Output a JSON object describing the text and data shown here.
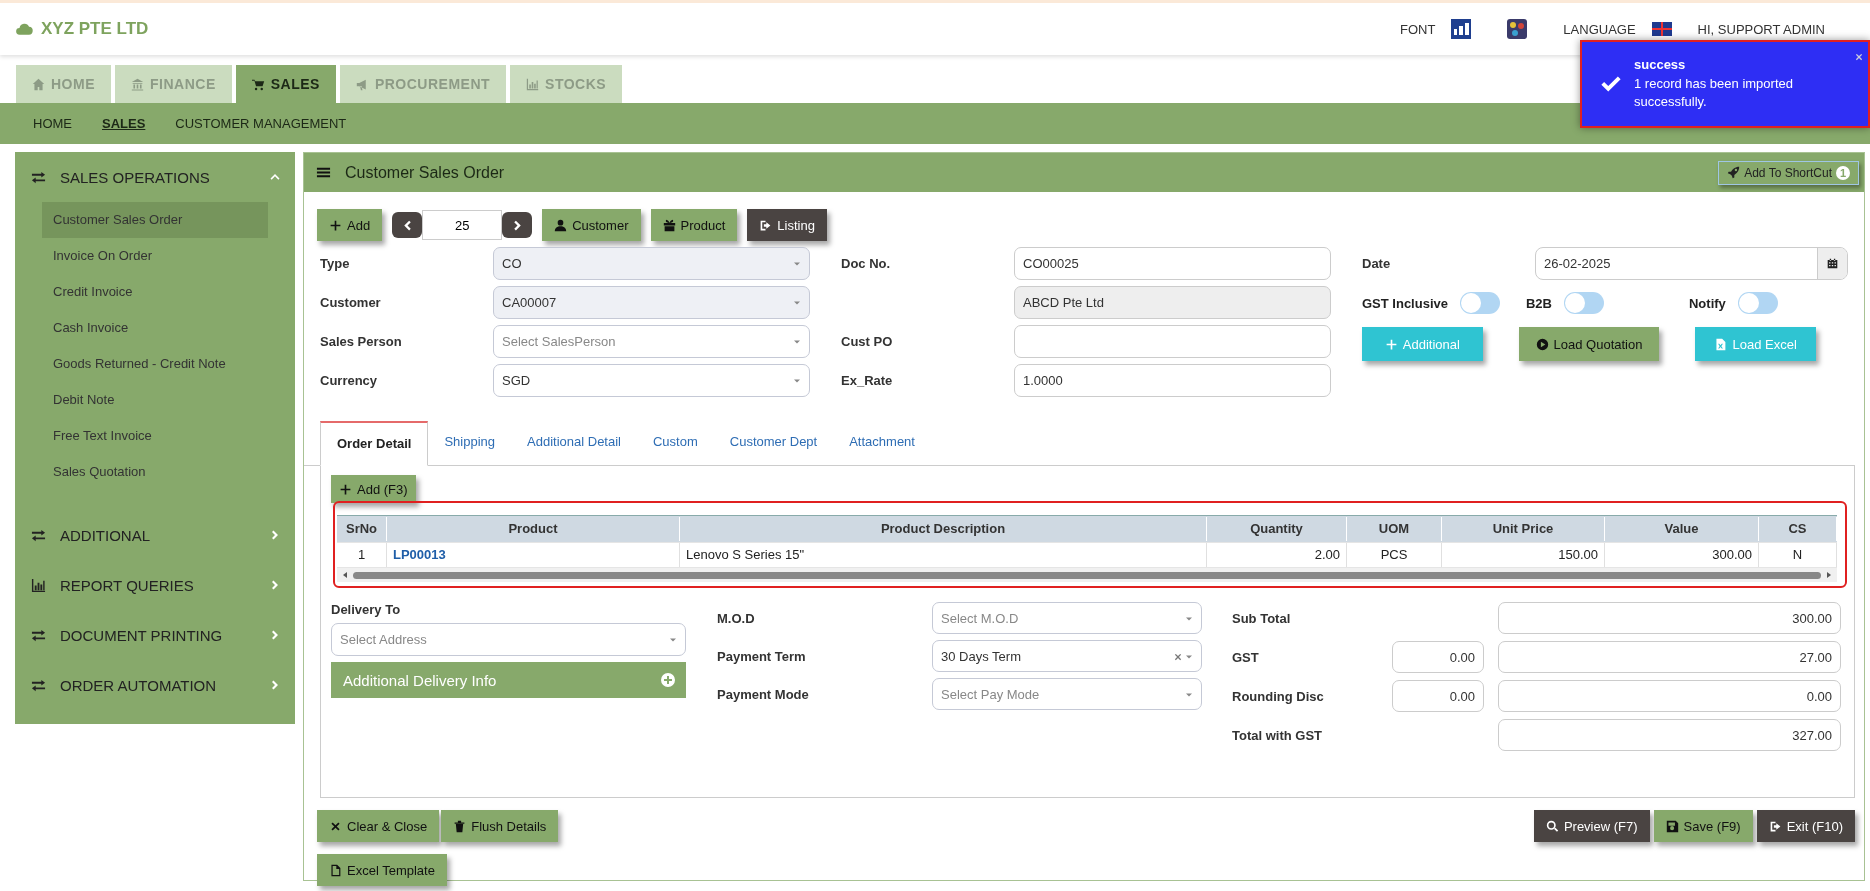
{
  "header": {
    "company": "XYZ PTE LTD",
    "font_label": "FONT",
    "language_label": "LANGUAGE",
    "user": "HI, SUPPORT ADMIN"
  },
  "toast": {
    "title": "success",
    "message": "1 record has been imported successfully."
  },
  "module_tabs": [
    {
      "label": "HOME",
      "selected": false
    },
    {
      "label": "FINANCE",
      "selected": false
    },
    {
      "label": "SALES",
      "selected": true
    },
    {
      "label": "PROCUREMENT",
      "selected": false
    },
    {
      "label": "STOCKS",
      "selected": false
    }
  ],
  "sub_nav": [
    {
      "label": "HOME",
      "selected": false
    },
    {
      "label": "SALES",
      "selected": true
    },
    {
      "label": "CUSTOMER MANAGEMENT",
      "selected": false
    }
  ],
  "sidebar": [
    {
      "title": "SALES OPERATIONS",
      "expanded": true,
      "children": [
        {
          "label": "Customer Sales Order",
          "selected": true
        },
        {
          "label": "Invoice On Order",
          "selected": false
        },
        {
          "label": "Credit Invoice",
          "selected": false
        },
        {
          "label": "Cash Invoice",
          "selected": false
        },
        {
          "label": "Goods Returned - Credit Note",
          "selected": false
        },
        {
          "label": "Debit Note",
          "selected": false
        },
        {
          "label": "Free Text Invoice",
          "selected": false
        },
        {
          "label": "Sales Quotation",
          "selected": false
        }
      ]
    },
    {
      "title": "ADDITIONAL",
      "expanded": false
    },
    {
      "title": "REPORT QUERIES",
      "expanded": false
    },
    {
      "title": "DOCUMENT PRINTING",
      "expanded": false
    },
    {
      "title": "ORDER AUTOMATION",
      "expanded": false
    }
  ],
  "page": {
    "title": "Customer Sales Order",
    "shortcut_button": "Add To ShortCut",
    "shortcut_count": "1"
  },
  "toolbar": {
    "add": "Add",
    "record_no": "25",
    "customer": "Customer",
    "product": "Product",
    "listing": "Listing"
  },
  "form_left": [
    {
      "label": "Type",
      "value": "CO",
      "disabled": true
    },
    {
      "label": "Customer",
      "value": "CA00007",
      "disabled": true
    },
    {
      "label": "Sales Person",
      "placeholder": "Select SalesPerson",
      "disabled": false
    },
    {
      "label": "Currency",
      "value": "SGD",
      "disabled": false
    }
  ],
  "form_mid": [
    {
      "label": "Doc No.",
      "value": "CO00025",
      "disabled": false
    },
    {
      "value": "ABCD Pte Ltd",
      "disabled": true
    },
    {
      "label": "Cust PO",
      "disabled": false
    },
    {
      "label": "Ex_Rate",
      "value": "1.0000",
      "disabled": false
    }
  ],
  "date": {
    "label": "Date",
    "value": "26-02-2025"
  },
  "toggles": [
    {
      "label": "GST Inclusive",
      "on": false
    },
    {
      "label": "B2B",
      "on": false
    },
    {
      "label": "Notify",
      "on": false
    }
  ],
  "action_buttons": [
    {
      "label": "Additional",
      "kind": "teal"
    },
    {
      "label": "Load Quotation",
      "kind": "green"
    },
    {
      "label": "Load Excel",
      "kind": "teal"
    }
  ],
  "detail_tabs": [
    {
      "label": "Order Detail",
      "selected": true
    },
    {
      "label": "Shipping",
      "selected": false
    },
    {
      "label": "Additional Detail",
      "selected": false
    },
    {
      "label": "Custom",
      "selected": false
    },
    {
      "label": "Customer Dept",
      "selected": false
    },
    {
      "label": "Attachment",
      "selected": false
    }
  ],
  "grid_add_button": "Add (F3)",
  "table": {
    "columns": [
      "SrNo",
      "Product",
      "Product Description",
      "Quantity",
      "UOM",
      "Unit Price",
      "Value",
      "CS"
    ],
    "rows": [
      [
        "1",
        "LP00013",
        "Lenovo S Series 15\"",
        "2.00",
        "PCS",
        "150.00",
        "300.00",
        "N"
      ]
    ]
  },
  "delivery": {
    "label": "Delivery To",
    "placeholder": "Select Address",
    "info_bar": "Additional Delivery Info"
  },
  "terms": [
    {
      "label": "M.O.D",
      "placeholder": "Select M.O.D",
      "clearable": false
    },
    {
      "label": "Payment Term",
      "value": "30 Days Term",
      "clearable": true
    },
    {
      "label": "Payment Mode",
      "placeholder": "Select Pay Mode",
      "clearable": false
    }
  ],
  "totals": [
    {
      "label": "Sub Total",
      "amount": "300.00"
    },
    {
      "label": "GST",
      "rate": "0.00",
      "amount": "27.00"
    },
    {
      "label": "Rounding Disc",
      "rate": "0.00",
      "amount": "0.00"
    },
    {
      "label": "Total with GST",
      "amount": "327.00"
    }
  ],
  "bottom_left": [
    {
      "label": "Clear & Close",
      "kind": "green"
    },
    {
      "label": "Flush Details",
      "kind": "green"
    },
    {
      "label": "Excel Template",
      "kind": "green"
    }
  ],
  "bottom_right": [
    {
      "label": "Preview (F7)",
      "kind": "dark"
    },
    {
      "label": "Save (F9)",
      "kind": "green"
    },
    {
      "label": "Exit (F10)",
      "kind": "dark"
    }
  ]
}
